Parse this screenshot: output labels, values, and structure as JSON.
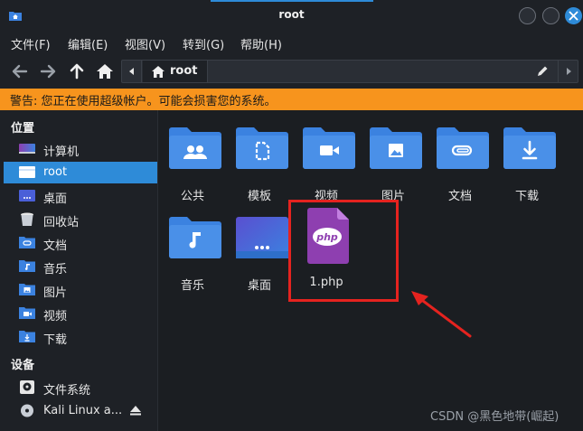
{
  "window": {
    "title": "root"
  },
  "menu": [
    "文件(F)",
    "编辑(E)",
    "视图(V)",
    "转到(G)",
    "帮助(H)"
  ],
  "path": {
    "crumb": "root"
  },
  "warning": "警告: 您正在使用超级帐户。可能会损害您的系统。",
  "sidebar": {
    "places_heading": "位置",
    "places": [
      {
        "label": "计算机",
        "icon": "computer-icon"
      },
      {
        "label": "root",
        "icon": "home-folder-icon",
        "active": true
      },
      {
        "label": "桌面",
        "icon": "desktop-folder-icon"
      },
      {
        "label": "回收站",
        "icon": "trash-icon"
      },
      {
        "label": "文档",
        "icon": "documents-folder-icon"
      },
      {
        "label": "音乐",
        "icon": "music-folder-icon"
      },
      {
        "label": "图片",
        "icon": "pictures-folder-icon"
      },
      {
        "label": "视频",
        "icon": "videos-folder-icon"
      },
      {
        "label": "下载",
        "icon": "downloads-folder-icon"
      }
    ],
    "devices_heading": "设备",
    "devices": [
      {
        "label": "文件系统",
        "icon": "drive-icon"
      },
      {
        "label": "Kali Linux a...",
        "icon": "optical-disc-icon"
      }
    ]
  },
  "files": [
    {
      "label": "公共",
      "icon": "public-folder-icon"
    },
    {
      "label": "模板",
      "icon": "templates-folder-icon"
    },
    {
      "label": "视频",
      "icon": "videos-folder-icon"
    },
    {
      "label": "图片",
      "icon": "pictures-folder-icon"
    },
    {
      "label": "文档",
      "icon": "documents-folder-icon"
    },
    {
      "label": "下载",
      "icon": "downloads-folder-icon"
    },
    {
      "label": "音乐",
      "icon": "music-folder-icon"
    },
    {
      "label": "桌面",
      "icon": "desktop-folder-icon"
    },
    {
      "label": "1.php",
      "icon": "php-file-icon"
    }
  ],
  "php_badge": "php",
  "watermark": "CSDN @黑色地带(崛起)",
  "colors": {
    "accent": "#2e8bd8",
    "warning": "#f7941d",
    "folder": "#3b82e0",
    "php": "#8e3fb0",
    "annotation": "#e5231f"
  }
}
